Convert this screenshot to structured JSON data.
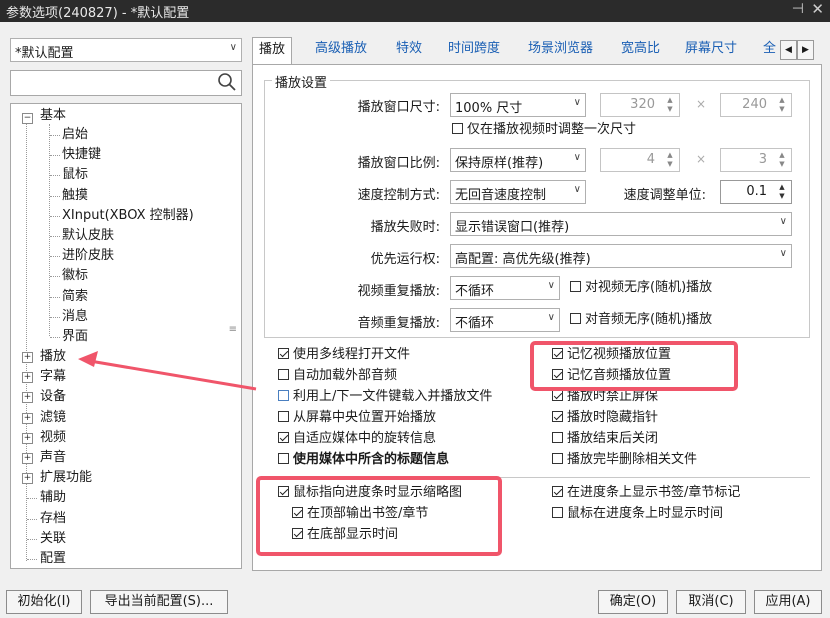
{
  "window": {
    "title": "参数选项(240827) - *默认配置"
  },
  "config_select": {
    "value": "*默认配置"
  },
  "tree": {
    "basic": "基本",
    "basic_children": [
      "启始",
      "快捷键",
      "鼠标",
      "触摸",
      "XInput(XBOX 控制器)",
      "默认皮肤",
      "进阶皮肤",
      "徽标",
      "简索",
      "消息",
      "界面"
    ],
    "top_items": [
      "播放",
      "字幕",
      "设备",
      "滤镜",
      "视频",
      "声音",
      "扩展功能",
      "辅助",
      "存档",
      "关联",
      "配置"
    ]
  },
  "tabs": [
    "播放",
    "高级播放",
    "特效",
    "时间跨度",
    "场景浏览器",
    "宽高比",
    "屏幕尺寸",
    "全"
  ],
  "playback": {
    "group_title": "播放设置",
    "window_size_label": "播放窗口尺寸:",
    "window_size_value": "100% 尺寸",
    "width": "320",
    "height": "240",
    "adjust_once": "仅在播放视频时调整一次尺寸",
    "ratio_label": "播放窗口比例:",
    "ratio_value": "保持原样(推荐)",
    "ratio_w": "4",
    "ratio_h": "3",
    "speed_mode_label": "速度控制方式:",
    "speed_mode_value": "无回音速度控制",
    "speed_unit_label": "速度调整单位:",
    "speed_unit_value": "0.1",
    "fail_label": "播放失败时:",
    "fail_value": "显示错误窗口(推荐)",
    "priority_label": "优先运行权:",
    "priority_value": "高配置: 高优先级(推荐)",
    "video_repeat_label": "视频重复播放:",
    "video_repeat_value": "不循环",
    "video_random": "对视频无序(随机)播放",
    "audio_repeat_label": "音频重复播放:",
    "audio_repeat_value": "不循环",
    "audio_random": "对音频无序(随机)播放"
  },
  "options_left": [
    {
      "label": "使用多线程打开文件",
      "checked": true
    },
    {
      "label": "自动加载外部音频",
      "checked": false
    },
    {
      "label": "利用上/下一文件键载入并播放文件",
      "checked": false
    },
    {
      "label": "从屏幕中央位置开始播放",
      "checked": false
    },
    {
      "label": "自适应媒体中的旋转信息",
      "checked": true
    },
    {
      "label": "使用媒体中所含的标题信息",
      "checked": false
    }
  ],
  "options_right": [
    {
      "label": "记忆视频播放位置",
      "checked": true
    },
    {
      "label": "记忆音频播放位置",
      "checked": true
    },
    {
      "label": "播放时禁止屏保",
      "checked": true
    },
    {
      "label": "播放时隐藏指针",
      "checked": true
    },
    {
      "label": "播放结束后关闭",
      "checked": false
    },
    {
      "label": "播放完毕删除相关文件",
      "checked": false
    }
  ],
  "seek": {
    "thumb": {
      "label": "鼠标指向进度条时显示缩略图",
      "checked": true
    },
    "top_bookmark": {
      "label": "在顶部输出书签/章节",
      "checked": true
    },
    "bottom_time": {
      "label": "在底部显示时间",
      "checked": true
    },
    "bookmark_marks": {
      "label": "在进度条上显示书签/章节标记",
      "checked": true
    },
    "hover_time": {
      "label": "鼠标在进度条上时显示时间",
      "checked": false
    }
  },
  "buttons": {
    "init": "初始化(I)",
    "export": "导出当前配置(S)...",
    "ok": "确定(O)",
    "cancel": "取消(C)",
    "apply": "应用(A)"
  },
  "colors": {
    "highlight": "#f0556a",
    "link": "#1a5fb4"
  }
}
